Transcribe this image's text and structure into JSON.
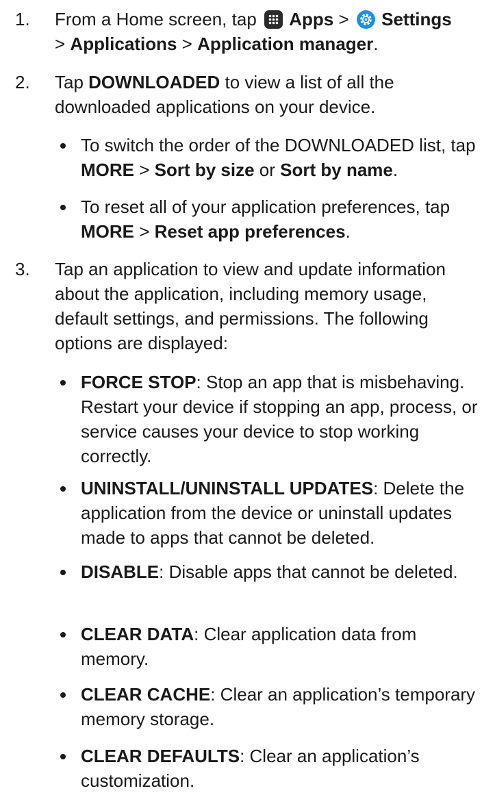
{
  "steps": {
    "s1": {
      "num": "1.",
      "t1": "From a Home screen, tap ",
      "apps": "Apps",
      "gt1": " > ",
      "settings": "Settings",
      "gt2": "> ",
      "applications": "Applications",
      "gt3": " > ",
      "app_manager": "Application manager",
      "end": "."
    },
    "s2": {
      "num": "2.",
      "t1": "Tap ",
      "downloaded": "DOWNLOADED",
      "t2": " to view a list of all the downloaded applications on your device."
    },
    "s2_bullets": {
      "b1": {
        "t1": "To switch the order of the DOWNLOADED list, tap ",
        "more": "MORE",
        "gt": " > ",
        "sort_size": "Sort by size",
        "or": " or ",
        "sort_name": "Sort by name",
        "end": "."
      },
      "b2": {
        "t1": "To reset all of your application preferences, tap ",
        "more": "MORE",
        "gt": " > ",
        "reset": "Reset app preferences",
        "end": "."
      }
    },
    "s3": {
      "num": "3.",
      "text": "Tap an application to view and update information about the application, including memory usage, default settings, and permissions. The following options are displayed:"
    },
    "s3_bullets": {
      "force_stop": {
        "label": "FORCE STOP",
        "desc": ": Stop an app that is misbehaving. Restart your device if stopping an app, process, or service causes your device to stop working correctly."
      },
      "uninstall": {
        "label": "UNINSTALL/UNINSTALL UPDATES",
        "desc": ": Delete the application from the device or uninstall updates made to apps that cannot be deleted."
      },
      "disable": {
        "label": "DISABLE",
        "desc": ": Disable apps that cannot be deleted."
      },
      "clear_data": {
        "label": "CLEAR DATA",
        "desc": ": Clear application data from memory."
      },
      "clear_cache": {
        "label": "CLEAR CACHE",
        "desc": ": Clear an application’s temporary memory storage."
      },
      "clear_defaults": {
        "label": "CLEAR DEFAULTS",
        "desc": ": Clear an application’s customization."
      }
    }
  },
  "icons": {
    "apps": "apps-grid-icon",
    "settings": "gear-icon"
  },
  "colors": {
    "text": "#1a1a1a",
    "settings_icon": "#1f8fe0",
    "apps_icon": "#2b2b2b"
  }
}
